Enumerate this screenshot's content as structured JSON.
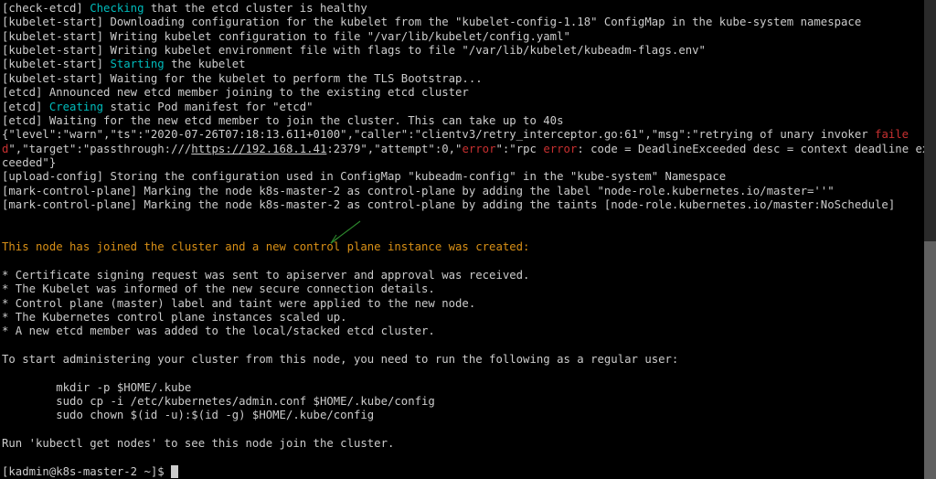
{
  "prompt": "[kadmin@k8s-master-2 ~]$ ",
  "l": {
    "0": {
      "a": "[check-etcd] ",
      "b": "Checking",
      "c": " that the etcd cluster is healthy"
    },
    "1": {
      "a": "[kubelet-start] Downloading configuration for the kubelet from the \"kubelet-config-1.18\" ConfigMap in the kube-system namespace"
    },
    "2": {
      "a": "[kubelet-start] Writing kubelet configuration to file \"/var/lib/kubelet/config.yaml\""
    },
    "3": {
      "a": "[kubelet-start] Writing kubelet environment file with flags to file \"/var/lib/kubelet/kubeadm-flags.env\""
    },
    "4": {
      "a": "[kubelet-start] ",
      "b": "Starting",
      "c": " the kubelet"
    },
    "5": {
      "a": "[kubelet-start] Waiting for the kubelet to perform the TLS Bootstrap..."
    },
    "6": {
      "a": "[etcd] Announced new etcd member joining to the existing etcd cluster"
    },
    "7": {
      "a": "[etcd] ",
      "b": "Creating",
      "c": " static Pod manifest for \"etcd\""
    },
    "8": {
      "a": "[etcd] Waiting for the new etcd member to join the cluster. This can take up to 40s"
    },
    "9": {
      "a": "{\"level\":\"warn\",\"ts\":\"2020-07-26T07:18:13.611+0100\",\"caller\":\"clientv3/retry_interceptor.go:61\",\"msg\":\"retrying of unary invoker ",
      "b": "failed",
      "c": "\",\"target\":\"passthrough:///",
      "d": "https://192.168.1.41",
      "e": ":2379\",\"attempt\":0,\"",
      "f": "error",
      "g": "\":\"rpc ",
      "h": "error",
      "i": ": code = DeadlineExceeded desc = context deadline exceeded\"}"
    },
    "10": {
      "a": "[upload-config] Storing the configuration used in ConfigMap \"kubeadm-config\" in the \"kube-system\" Namespace"
    },
    "11": {
      "a": "[mark-control-plane] Marking the node k8s-master-2 as control-plane by adding the label \"node-role.kubernetes.io/master=''\""
    },
    "12": {
      "a": "[mark-control-plane] Marking the node k8s-master-2 as control-plane by adding the taints [node-role.kubernetes.io/master:NoSchedule]"
    },
    "13": {
      "a": ""
    },
    "15": {
      "a": "This node has joined the cluster and a new control plane instance was created:"
    },
    "17": {
      "a": "* Certificate signing request was sent to apiserver and approval was received."
    },
    "18": {
      "a": "* The Kubelet was informed of the new secure connection details."
    },
    "19": {
      "a": "* Control plane (master) label and taint were applied to the new node."
    },
    "20": {
      "a": "* The Kubernetes control plane instances scaled up."
    },
    "21": {
      "a": "* A new etcd member was added to the local/stacked etcd cluster."
    },
    "23": {
      "a": "To start administering your cluster from this node, you need to run the following as a regular user:"
    },
    "25": {
      "a": "        mkdir -p $HOME/.kube"
    },
    "26": {
      "a": "        sudo cp -i /etc/kubernetes/admin.conf $HOME/.kube/config"
    },
    "27": {
      "a": "        sudo chown $(id -u):$(id -g) $HOME/.kube/config"
    },
    "29": {
      "a": "Run 'kubectl get nodes' to see this node join the cluster."
    }
  }
}
